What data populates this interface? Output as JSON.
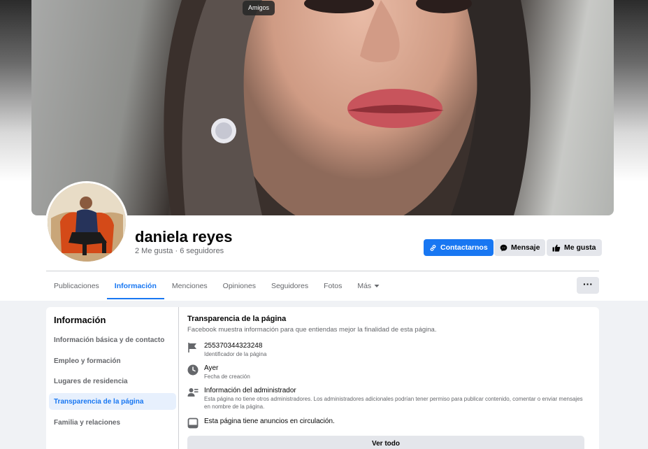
{
  "tooltip": "Amigos",
  "profile": {
    "name": "daniela reyes",
    "stats": "2 Me gusta · 6 seguidores"
  },
  "actions": {
    "contact": "Contactarnos",
    "message": "Mensaje",
    "like": "Me gusta",
    "more": "···"
  },
  "tabs": [
    "Publicaciones",
    "Información",
    "Menciones",
    "Opiniones",
    "Seguidores",
    "Fotos",
    "Más"
  ],
  "active_tab": "Información",
  "sidebar": {
    "title": "Información",
    "items": [
      "Información básica y de contacto",
      "Empleo y formación",
      "Lugares de residencia",
      "Transparencia de la página",
      "Familia y relaciones"
    ],
    "active_item": "Transparencia de la página"
  },
  "transparency": {
    "title": "Transparencia de la página",
    "description": "Facebook muestra información para que entiendas mejor la finalidad de esta página.",
    "page_id": "255370344323248",
    "page_id_label": "Identificador de la página",
    "created": "Ayer",
    "created_label": "Fecha de creación",
    "admin_title": "Información del administrador",
    "admin_text": "Esta página no tiene otros administradores. Los administradores adicionales podrían tener permiso para publicar contenido, comentar o enviar mensajes en nombre de la página.",
    "ads": "Esta página tiene anuncios en circulación.",
    "see_all": "Ver todo"
  },
  "colors": {
    "primary": "#1877f2",
    "secondary_bg": "#e4e6eb",
    "muted_text": "#65676b",
    "page_bg": "#f0f2f5"
  }
}
